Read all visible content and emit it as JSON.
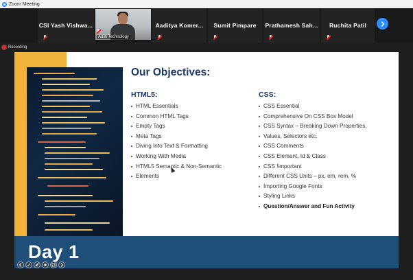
{
  "window": {
    "title": "Zoom Meeting"
  },
  "participants": [
    {
      "name": "CSI  Yash  Vishwa..."
    },
    {
      "name": "Aaditya  Komer..."
    },
    {
      "name": "Sumit Pimpare"
    },
    {
      "name": "Prathamesh  Sah..."
    },
    {
      "name": "Ruchita Patil"
    }
  ],
  "video_tile": {
    "label": "Adiiti Technology"
  },
  "recording": {
    "label": "Recording"
  },
  "slide": {
    "title": "Our Objectives:",
    "html_heading": "HTML5:",
    "html_items": [
      "HTML Essentials",
      "Common HTML Tags",
      "Empty Tags",
      "Meta Tags",
      "Diving Into Text & Formatting",
      "Working With Media",
      "HTML5 Semantic & Non-Semantic",
      "Elements"
    ],
    "css_heading": "CSS:",
    "css_items": [
      "CSS Essential",
      "Comprehensive On CSS Box Model",
      "CSS Syntax – Breaking Down Properties,",
      "Values, Selectors etc.",
      "CSS Comments",
      "CSS Element, Id & Class",
      "CSS !important",
      "Different CSS Units – px, em, rem, %",
      "Importing Google Fonts",
      "Styling Links",
      "Question/Answer and Fun Activity"
    ],
    "day_label": "Day 1"
  },
  "colors": {
    "accent_blue": "#1f4e79",
    "title_navy": "#1f3864",
    "yellow": "#f2b33a",
    "zoom_blue": "#2d8cff",
    "recording_red": "#e02828"
  },
  "icons": [
    "zoom-logo-icon",
    "mic-muted-icon",
    "chevron-right-icon",
    "recording-dot-icon",
    "annotation-tool-icon"
  ]
}
